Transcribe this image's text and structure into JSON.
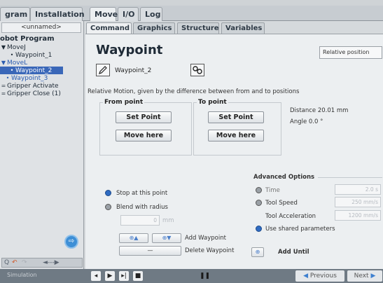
{
  "top_tabs": {
    "program": "gram",
    "installation": "Installation",
    "move": "Move",
    "io": "I/O",
    "log": "Log"
  },
  "left_panel": {
    "program_name": "<unnamed>",
    "tree": [
      {
        "label": "obot Program",
        "marker": "",
        "style": "bold"
      },
      {
        "label": "MoveJ",
        "marker": "▼",
        "style": ""
      },
      {
        "label": "Waypoint_1",
        "marker": "•",
        "style": "indent"
      },
      {
        "label": "MoveL",
        "marker": "▼",
        "style": "blue"
      },
      {
        "label": "Waypoint_2",
        "marker": "•",
        "style": "selected"
      },
      {
        "label": "Waypoint_3",
        "marker": "•",
        "style": "blue"
      },
      {
        "label": "Gripper Activate",
        "marker": "=",
        "style": ""
      },
      {
        "label": "Gripper Close (1)",
        "marker": "=",
        "style": ""
      }
    ],
    "tools_left": "Q",
    "tools_right": "◄---▶"
  },
  "sub_tabs": {
    "command": "Command",
    "graphics": "Graphics",
    "structure": "Structure",
    "variables": "Variables"
  },
  "waypoint": {
    "title": "Waypoint",
    "position_mode": "Relative position",
    "name": "Waypoint_2",
    "description": "Relative Motion, given by the difference between from and to positions",
    "from_point_label": "From point",
    "to_point_label": "To point",
    "set_point": "Set Point",
    "move_here": "Move here",
    "distance": "Distance 20.01 mm",
    "angle": "Angle 0.0 °"
  },
  "stop_options": {
    "stop_at_point": "Stop at this point",
    "blend_with_radius": "Blend with radius",
    "blend_value": "0",
    "blend_unit": "mm"
  },
  "advanced": {
    "title": "Advanced Options",
    "time_label": "Time",
    "time_value": "2.0 s",
    "tool_speed_label": "Tool Speed",
    "tool_speed_value": "250 mm/s",
    "tool_accel_label": "Tool Acceleration",
    "tool_accel_value": "1200 mm/s",
    "shared_params": "Use shared parameters"
  },
  "waypoint_actions": {
    "add_waypoint": "Add Waypoint",
    "delete_waypoint": "Delete Waypoint",
    "add_until": "Add Until",
    "delete_symbol": "—"
  },
  "bottom_bar": {
    "simulation": "Simulation",
    "previous": "Previous",
    "next": "Next"
  },
  "colors": {
    "selection": "#3a67b8",
    "accent": "#3d7fcf",
    "panel": "#eceff1"
  }
}
